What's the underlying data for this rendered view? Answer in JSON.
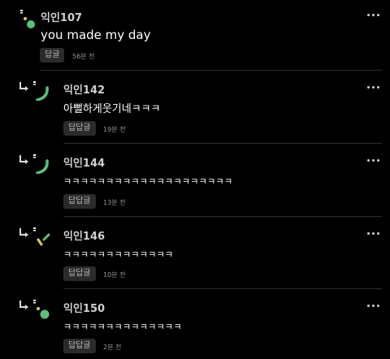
{
  "comments": [
    {
      "name": "익인107",
      "text": "you made my day",
      "reply_label": "답글",
      "time": "56분 전",
      "reply": false
    },
    {
      "name": "익인142",
      "text": "아뻘하게웃기네ㅋㅋㅋ",
      "reply_label": "답답글",
      "time": "19분 전",
      "reply": true
    },
    {
      "name": "익인144",
      "text": "ㅋㅋㅋㅋㅋㅋㅋㅋㅋㅋㅋㅋㅋㅋㅋㅋㅋㅋㅋㅋ",
      "reply_label": "답답글",
      "time": "13분 전",
      "reply": true
    },
    {
      "name": "익인146",
      "text": "ㅋㅋㅋㅋㅋㅋㅋㅋㅋㅋㅋㅋㅋ",
      "reply_label": "답답글",
      "time": "10분 전",
      "reply": true
    },
    {
      "name": "익인150",
      "text": "ㅋㅋㅋㅋㅋㅋㅋㅋㅋㅋㅋㅋㅋㅋ",
      "reply_label": "답답글",
      "time": "2분 전",
      "reply": true
    }
  ],
  "icons": {
    "more": "more-options-icon",
    "reply": "reply-arrow-icon",
    "avatar": "anonymous-avatar"
  },
  "colors": {
    "background": "#000000",
    "avatar_green": "#5cc07b",
    "avatar_yellow": "#d9d254",
    "button_bg": "#2b2b2b"
  }
}
